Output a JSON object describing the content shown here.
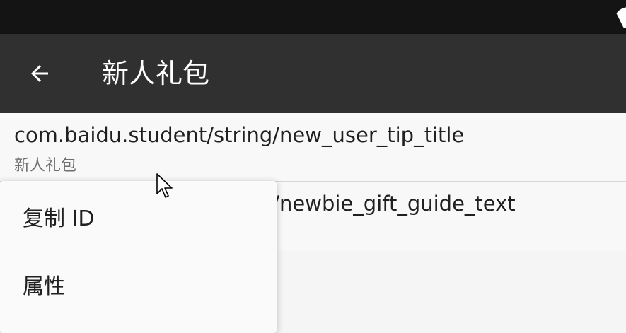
{
  "status_bar": {
    "wifi_icon": "wifi-signal-icon"
  },
  "app_bar": {
    "back_icon": "arrow-left-icon",
    "title": "新人礼包"
  },
  "list": {
    "items": [
      {
        "title": "com.baidu.student/string/new_user_tip_title",
        "subtitle": "新人礼包"
      },
      {
        "title": "com.baidu.student/string/newbie_gift_guide_text",
        "subtitle": ""
      }
    ]
  },
  "context_menu": {
    "items": [
      {
        "label": "复制 ID"
      },
      {
        "label": "属性"
      }
    ]
  },
  "colors": {
    "status_bar": "#141414",
    "app_bar": "#303030",
    "background": "#f5f5f5"
  }
}
